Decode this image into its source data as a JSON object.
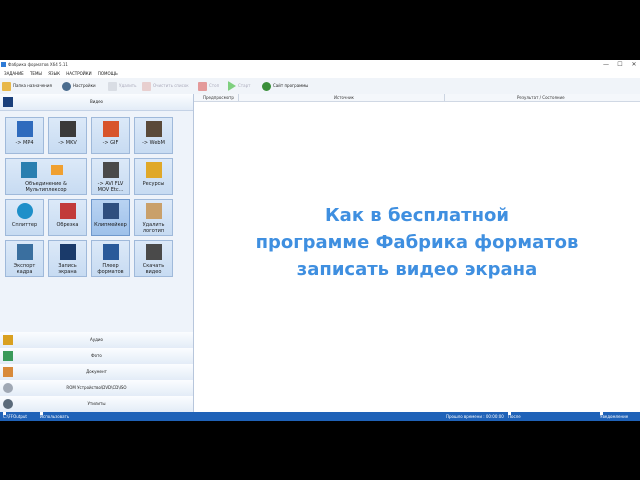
{
  "window": {
    "title": "Фабрика форматов X64 5.11",
    "min": "—",
    "max": "☐",
    "close": "✕"
  },
  "menu": [
    "ЗАДАНИЕ",
    "ТЕМЫ",
    "ЯЗЫК",
    "НАСТРОЙКИ",
    "ПОМОЩЬ"
  ],
  "toolbar": {
    "output_folder": "Папка назначения",
    "settings": "Настройки",
    "remove": "Удалить",
    "clear_list": "Очистить список",
    "stop": "Стоп",
    "start": "Старт",
    "website": "Сайт программы"
  },
  "categories": {
    "video": "Видео",
    "audio": "Аудио",
    "photo": "Фото",
    "document": "Документ",
    "rom": "ROM Устройство\\DVD\\CD\\ISO",
    "utilities": "Утилиты"
  },
  "tiles": [
    "-> MP4",
    "-> MKV",
    "-> GIF",
    "-> WebM",
    "Объединение & Мультиплексор",
    "",
    "-> AVI FLV MOV Etc...",
    "Ресурсы",
    "Сплиттер",
    "Обрезка",
    "Клипмейкер",
    "Удалить логотип",
    "Экспорт кадра",
    "Запись экрана",
    "Плеер форматов",
    "Скачать видео"
  ],
  "columns": {
    "preview": "Предпросмотр",
    "source": "Источник",
    "result": "Результат / Состояние"
  },
  "overlay": {
    "line1": "Как в бесплатной",
    "line2": "программе Фабрика форматов",
    "line3": "записать видео экрана"
  },
  "status": {
    "output_path": "C:\\FFOutput",
    "multithread": "Использовать многопоточность",
    "elapsed": "Прошло времени : 00:00:00",
    "after_convert": "После конвертации : Выключить ПК",
    "notify": "Уведомление"
  },
  "colors": {
    "accent": "#3f8fe0",
    "status_bar": "#1f62b8"
  }
}
